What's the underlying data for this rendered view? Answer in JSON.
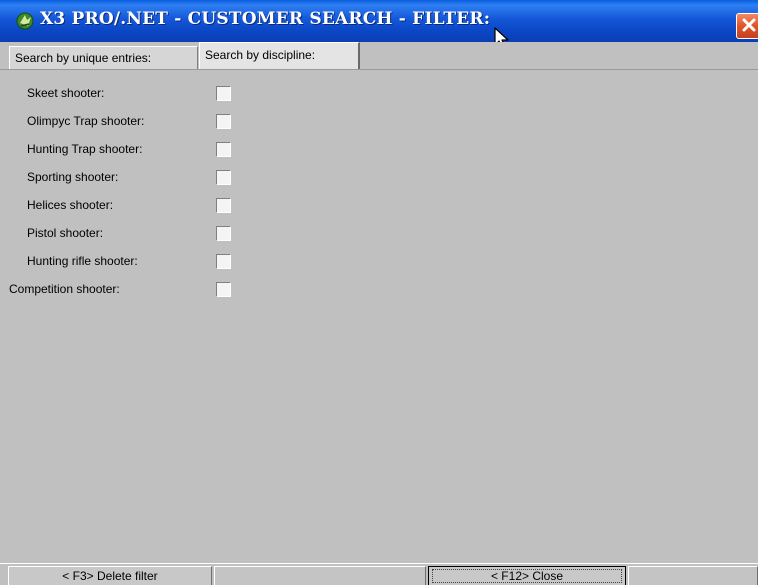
{
  "window": {
    "title": "X3 PRO/.NET - CUSTOMER SEARCH - FILTER:",
    "title_color": "#0b4fd4",
    "close_color": "#e2542a"
  },
  "tabs": [
    {
      "label": "Search by unique entries:",
      "active": false
    },
    {
      "label": "Search by discipline:",
      "active": true
    }
  ],
  "disciplines": [
    {
      "label": "Skeet shooter:",
      "checked": false
    },
    {
      "label": "Olimpyc Trap shooter:",
      "checked": false
    },
    {
      "label": "Hunting Trap shooter:",
      "checked": false
    },
    {
      "label": "Sporting shooter:",
      "checked": false
    },
    {
      "label": "Helices shooter:",
      "checked": false
    },
    {
      "label": "Pistol shooter:",
      "checked": false
    },
    {
      "label": "Hunting rifle shooter:",
      "checked": false
    },
    {
      "label": "Competition shooter:",
      "checked": false
    }
  ],
  "statusbar": {
    "delete_filter": "< F3> Delete filter",
    "close": "< F12> Close"
  },
  "icons": {
    "app": "app-logo-icon",
    "close": "close-icon",
    "cursor": "mouse-cursor-icon"
  }
}
